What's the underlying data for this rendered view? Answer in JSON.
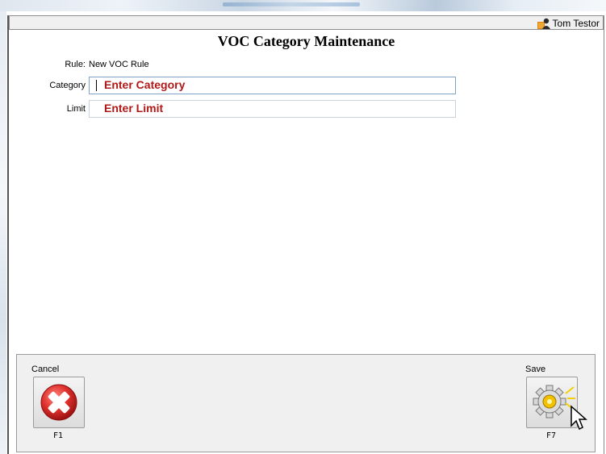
{
  "header": {
    "user_name": "Tom Testor",
    "page_title": "VOC Category Maintenance"
  },
  "form": {
    "rule_label": "Rule:",
    "rule_value": "New VOC Rule",
    "category_label": "Category",
    "category_placeholder": "Enter Category",
    "limit_label": "Limit",
    "limit_placeholder": "Enter Limit"
  },
  "footer": {
    "cancel_label": "Cancel",
    "cancel_key": "F1",
    "save_label": "Save",
    "save_key": "F7"
  },
  "colors": {
    "placeholder_text": "#b01818",
    "cancel_icon": "#e0322e",
    "save_icon": "#f2c200"
  },
  "icons": {
    "user": "user-avatar-icon",
    "cancel": "cancel-x-icon",
    "save": "gear-icon",
    "cursor": "mouse-pointer-icon"
  }
}
